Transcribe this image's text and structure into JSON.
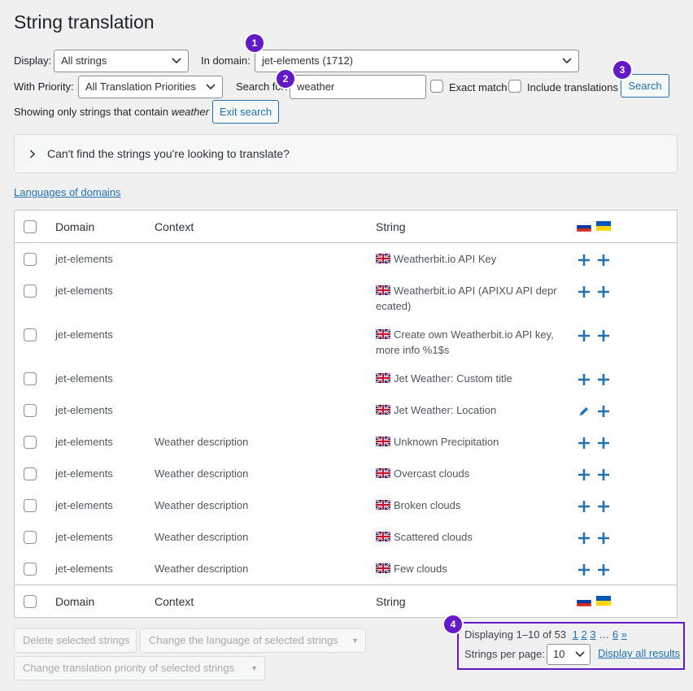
{
  "page": {
    "title": "String translation"
  },
  "filters": {
    "display_label": "Display:",
    "display_value": "All strings",
    "domain_label": "In domain:",
    "domain_value": "jet-elements (1712)",
    "priority_label": "With Priority:",
    "priority_value": "All Translation Priorities",
    "search_label": "Search for:",
    "search_value": "weather",
    "exact_match_label": "Exact match",
    "include_translations_label": "Include translations",
    "search_button": "Search"
  },
  "search_notice": {
    "prefix": "Showing only strings that contain",
    "term": "weather",
    "exit_button": "Exit search"
  },
  "help_panel": {
    "label": "Can't find the strings you're looking to translate?"
  },
  "languages_link": "Languages of domains",
  "table": {
    "headers": {
      "domain": "Domain",
      "context": "Context",
      "string": "String"
    },
    "rows": [
      {
        "domain": "jet-elements",
        "context": "",
        "string_lines": [
          "Weatherbit.io API Key"
        ],
        "ru": "add",
        "ua": "add"
      },
      {
        "domain": "jet-elements",
        "context": "",
        "string_lines": [
          "Weatherbit.io API (APIXU API depr",
          "ecated)"
        ],
        "ru": "add",
        "ua": "add"
      },
      {
        "domain": "jet-elements",
        "context": "",
        "string_lines": [
          "Create own Weatherbit.io API key,",
          "more info %1$s"
        ],
        "ru": "add",
        "ua": "add"
      },
      {
        "domain": "jet-elements",
        "context": "",
        "string_lines": [
          "Jet Weather: Custom title"
        ],
        "ru": "add",
        "ua": "add"
      },
      {
        "domain": "jet-elements",
        "context": "",
        "string_lines": [
          "Jet Weather: Location"
        ],
        "ru": "edit",
        "ua": "add"
      },
      {
        "domain": "jet-elements",
        "context": "Weather description",
        "string_lines": [
          "Unknown Precipitation"
        ],
        "ru": "add",
        "ua": "add"
      },
      {
        "domain": "jet-elements",
        "context": "Weather description",
        "string_lines": [
          "Overcast clouds"
        ],
        "ru": "add",
        "ua": "add"
      },
      {
        "domain": "jet-elements",
        "context": "Weather description",
        "string_lines": [
          "Broken clouds"
        ],
        "ru": "add",
        "ua": "add"
      },
      {
        "domain": "jet-elements",
        "context": "Weather description",
        "string_lines": [
          "Scattered clouds"
        ],
        "ru": "add",
        "ua": "add"
      },
      {
        "domain": "jet-elements",
        "context": "Weather description",
        "string_lines": [
          "Few clouds"
        ],
        "ru": "add",
        "ua": "add"
      }
    ]
  },
  "bulk_actions": {
    "delete": "Delete selected strings",
    "change_language": "Change the language of selected strings",
    "change_priority": "Change translation priority of selected strings"
  },
  "pagination": {
    "displaying": "Displaying 1–10 of 53",
    "pages": [
      "1",
      "2",
      "3"
    ],
    "ellipsis": "…",
    "last_page": "6",
    "next": "»",
    "per_page_label": "Strings per page:",
    "per_page_value": "10",
    "display_all": "Display all results"
  },
  "badges": [
    "1",
    "2",
    "3",
    "4"
  ],
  "colors": {
    "accent": "#2271b1",
    "badge": "#6319c8"
  }
}
